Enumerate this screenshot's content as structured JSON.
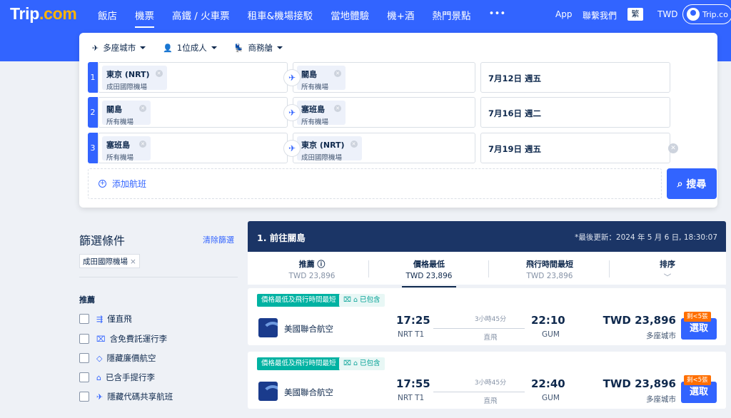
{
  "brand": {
    "name": "Trip",
    "suffix": ".com"
  },
  "nav": [
    "飯店",
    "機票",
    "高鐵 / 火車票",
    "租車&機場接駁",
    "當地體驗",
    "機+酒",
    "熱門景點",
    "•••"
  ],
  "nav_active": 1,
  "topright": {
    "app": "App",
    "contact": "聯繫我們",
    "lang": "繁",
    "currency": "TWD",
    "account": "Trip.co"
  },
  "search": {
    "trip_type": "多座城市",
    "passengers": "1位成人",
    "cabin": "商務艙",
    "legs": [
      {
        "num": "1",
        "from_city": "東京 (NRT)",
        "from_sub": "成田國際機場",
        "to_city": "關島",
        "to_sub": "所有機場",
        "date": "7月12日 週五"
      },
      {
        "num": "2",
        "from_city": "關島",
        "from_sub": "所有機場",
        "to_city": "塞班島",
        "to_sub": "所有機場",
        "date": "7月16日 週二"
      },
      {
        "num": "3",
        "from_city": "塞班島",
        "from_sub": "所有機場",
        "to_city": "東京 (NRT)",
        "to_sub": "成田國際機場",
        "date": "7月19日 週五"
      }
    ],
    "add_flight": "添加航班",
    "search_button": "搜尋"
  },
  "filters": {
    "title": "篩選條件",
    "clear": "清除篩選",
    "active_tag": "成田國際機場",
    "section": "推薦",
    "items": [
      "僅直飛",
      "含免費託運行李",
      "隱藏廉價航空",
      "已含手提行李",
      "隱藏代碼共享航班"
    ]
  },
  "results": {
    "header": "1. 前往關島",
    "updated": "*最後更新：2024 年 5 月 6 日, 18:30:07",
    "sort": [
      {
        "label": "推薦 ⓘ",
        "price": "TWD 23,896"
      },
      {
        "label": "價格最低",
        "price": "TWD 23,896"
      },
      {
        "label": "飛行時間最短",
        "price": "TWD 23,896"
      },
      {
        "label": "排序",
        "price": "﹀"
      }
    ],
    "sort_active": 1,
    "flights": [
      {
        "tag": "價格最低及飛行時間最短",
        "included": "已包含",
        "airline": "美國聯合航空",
        "dep_time": "17:25",
        "dep_airport": "NRT T1",
        "duration": "3小時45分",
        "stops": "直飛",
        "arr_time": "22:10",
        "arr_airport": "GUM",
        "price": "TWD 23,896",
        "price_note": "多座城市",
        "seats": "剩<5張",
        "select": "選取"
      },
      {
        "tag": "價格最低及飛行時間最短",
        "included": "已包含",
        "airline": "美國聯合航空",
        "dep_time": "17:55",
        "dep_airport": "NRT T1",
        "duration": "3小時45分",
        "stops": "直飛",
        "arr_time": "22:40",
        "arr_airport": "GUM",
        "price": "TWD 23,896",
        "price_note": "多座城市",
        "seats": "剩<5張",
        "select": "選取"
      }
    ]
  },
  "colors": {
    "primary": "#3264ff",
    "header_dark": "#1b3566",
    "tag_green": "#00b2a2",
    "seats_orange": "#ff6f00"
  }
}
